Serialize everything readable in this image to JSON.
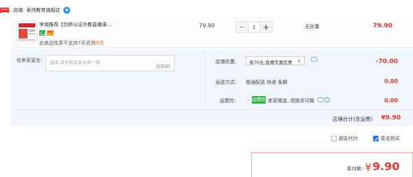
{
  "shop": {
    "label": "店铺:",
    "name": "柔持教育旗舰店",
    "icon": "wangwang-chat-icon"
  },
  "item": {
    "title": "李湘推荐【剑桥认证外教直播课...",
    "badges": [
      "guarantee-badge-icon",
      "card-badge-icon"
    ],
    "note": "此商品性质不支持7天退货",
    "note_link": "详情",
    "unit_price": "79.90",
    "quantity": "1",
    "minus_label": "−",
    "plus_label": "+",
    "discount": "无优惠",
    "line_total": "79.90"
  },
  "message": {
    "label": "给卖家留言:",
    "placeholder": "选填,请先和商家协商一致",
    "counter": "0/200"
  },
  "coupon": {
    "label": "店铺优惠:",
    "selected": "省70元:直播专属优惠",
    "amount": "-70.00"
  },
  "shipping": {
    "label": "运送方式:",
    "text": "普通配送 快递 免邮",
    "amount": "0.00"
  },
  "insurance": {
    "label": "运费险:",
    "badge": "运费险",
    "text": "卖家赠送, 退换货可赔",
    "amount": "0.00"
  },
  "shop_total": {
    "label": "店铺合计(含运费)",
    "value": "¥9.90"
  },
  "options": {
    "friend_pay": "朋友代付",
    "friend_pay_checked": false,
    "anonymous": "匿名购买",
    "anonymous_checked": true
  },
  "grand_total": {
    "label": "实付款:",
    "currency": "¥",
    "value": "9.90"
  },
  "colors": {
    "accent_red": "#e63a2e",
    "panel_blue": "#f2f7ff",
    "check_blue": "#2d6fe6",
    "green": "#2fb14a"
  }
}
